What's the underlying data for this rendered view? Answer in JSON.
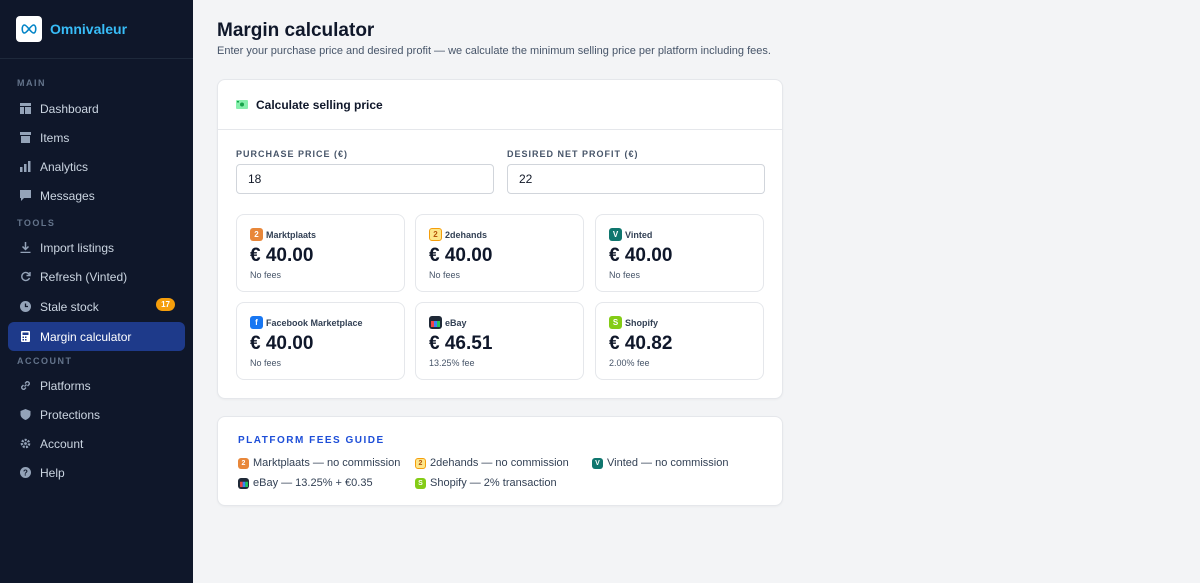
{
  "app": {
    "name": "Omnivaleur"
  },
  "sidebar": {
    "sections": [
      {
        "label": "MAIN"
      },
      {
        "label": "TOOLS"
      },
      {
        "label": "ACCOUNT"
      }
    ],
    "items": [
      {
        "label": "Dashboard",
        "icon": "dashboard-icon"
      },
      {
        "label": "Items",
        "icon": "box-icon"
      },
      {
        "label": "Analytics",
        "icon": "bar-chart-icon"
      },
      {
        "label": "Messages",
        "icon": "chat-icon"
      },
      {
        "label": "Import listings",
        "icon": "download-icon"
      },
      {
        "label": "Refresh (Vinted)",
        "icon": "refresh-icon"
      },
      {
        "label": "Stale stock",
        "icon": "clock-icon",
        "badge": "17"
      },
      {
        "label": "Margin calculator",
        "icon": "calculator-icon",
        "active": true
      },
      {
        "label": "Platforms",
        "icon": "link-icon"
      },
      {
        "label": "Protections",
        "icon": "shield-icon"
      },
      {
        "label": "Account",
        "icon": "settings-icon"
      },
      {
        "label": "Help",
        "icon": "help-icon"
      }
    ]
  },
  "page": {
    "title": "Margin calculator",
    "subtitle": "Enter your purchase price and desired profit — we calculate the minimum selling price per platform including fees."
  },
  "calculator": {
    "title": "Calculate selling price",
    "purchase_label": "PURCHASE PRICE (€)",
    "purchase_value": "18",
    "profit_label": "DESIRED NET PROFIT (€)",
    "profit_value": "22",
    "platforms": [
      {
        "name": "Marktplaats",
        "price": "€ 40.00",
        "fee": "No fees",
        "icon": "marktplaats-icon"
      },
      {
        "name": "2dehands",
        "price": "€ 40.00",
        "fee": "No fees",
        "icon": "2dehands-icon"
      },
      {
        "name": "Vinted",
        "price": "€ 40.00",
        "fee": "No fees",
        "icon": "vinted-icon"
      },
      {
        "name": "Facebook Marketplace",
        "price": "€ 40.00",
        "fee": "No fees",
        "icon": "facebook-icon"
      },
      {
        "name": "eBay",
        "price": "€ 46.51",
        "fee": "13.25% fee",
        "icon": "ebay-icon"
      },
      {
        "name": "Shopify",
        "price": "€ 40.82",
        "fee": "2.00% fee",
        "icon": "shopify-icon"
      }
    ]
  },
  "guide": {
    "title": "PLATFORM FEES GUIDE",
    "items": [
      {
        "text": "Marktplaats — no commission",
        "icon": "marktplaats-icon"
      },
      {
        "text": "2dehands — no commission",
        "icon": "2dehands-icon"
      },
      {
        "text": "Vinted — no commission",
        "icon": "vinted-icon"
      },
      {
        "text": "eBay — 13.25% + €0.35",
        "icon": "ebay-icon"
      },
      {
        "text": "Shopify — 2% transaction",
        "icon": "shopify-icon"
      }
    ]
  },
  "colors": {
    "sidebar_bg": "#0f172a",
    "active_bg": "#1e3a8a",
    "brand": "#38bdf8",
    "badge": "#f59e0b",
    "guide_title": "#1d4ed8"
  }
}
